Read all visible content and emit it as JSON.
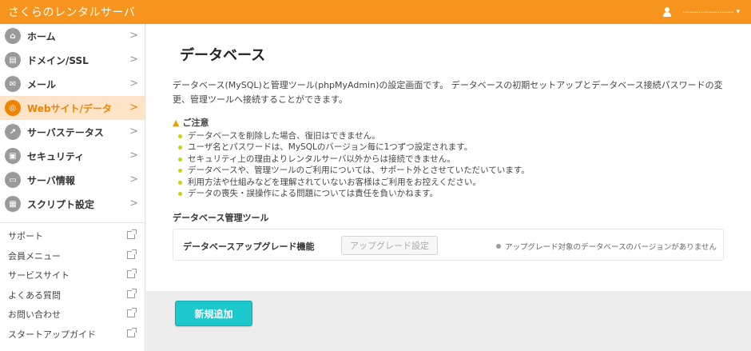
{
  "header": {
    "brand": "さくらのレンタルサーバ",
    "user_name": "ㅤ·····························",
    "caret": "▾"
  },
  "sidebar": {
    "items": [
      {
        "label": "ホーム",
        "icon": "home-icon",
        "glyph": "⌂",
        "chevron": ">"
      },
      {
        "label": "ドメイン/SSL",
        "icon": "domain-icon",
        "glyph": "▤",
        "chevron": ">"
      },
      {
        "label": "メール",
        "icon": "mail-icon",
        "glyph": "✉",
        "chevron": ">"
      },
      {
        "label": "Webサイト/データ",
        "icon": "globe-icon",
        "glyph": "◎",
        "chevron": ">"
      },
      {
        "label": "サーバステータス",
        "icon": "chart-icon",
        "glyph": "↗",
        "chevron": ">"
      },
      {
        "label": "セキュリティ",
        "icon": "lock-icon",
        "glyph": "▣",
        "chevron": ">"
      },
      {
        "label": "サーバ情報",
        "icon": "server-icon",
        "glyph": "▭",
        "chevron": ">"
      },
      {
        "label": "スクリプト設定",
        "icon": "script-icon",
        "glyph": "▦",
        "chevron": ">"
      }
    ],
    "active_index": 3,
    "links": [
      {
        "label": "サポート"
      },
      {
        "label": "会員メニュー"
      },
      {
        "label": "サービスサイト"
      },
      {
        "label": "よくある質問"
      },
      {
        "label": "お問い合わせ"
      },
      {
        "label": "スタートアップガイド"
      }
    ]
  },
  "main": {
    "title": "データベース",
    "description": "データベース(MySQL)と管理ツール(phpMyAdmin)の設定画面です。 データベースの初期セットアップとデータベース接続パスワードの変更、管理ツールへ接続することができます。",
    "notice": {
      "heading": "ご注意",
      "items": [
        "データベースを削除した場合、復旧はできません。",
        "ユーザ名とパスワードは、MySQLのバージョン毎に1つずつ設定されます。",
        "セキュリティ上の理由よりレンタルサーバ以外からは接続できません。",
        "データベースや、管理ツールのご利用については、サポート外とさせていただいています。",
        "利用方法や仕組みなどを理解されていないお客様はご利用をお控えください。",
        "データの喪失・誤操作による問題については責任を負いかねます。"
      ]
    },
    "tools": {
      "heading": "データベース管理ツール",
      "upgrade_label": "データベースアップグレード機能",
      "upgrade_button": "アップグレード設定",
      "status": "アップグレード対象のデータベースのバージョンがありません"
    },
    "new_button": "新規追加"
  },
  "colors": {
    "brand_orange": "#f7941d",
    "active_bg": "#fde4c9",
    "active_text": "#f08300",
    "accent_teal": "#1dc8cd",
    "bullet": "#c9d400"
  }
}
